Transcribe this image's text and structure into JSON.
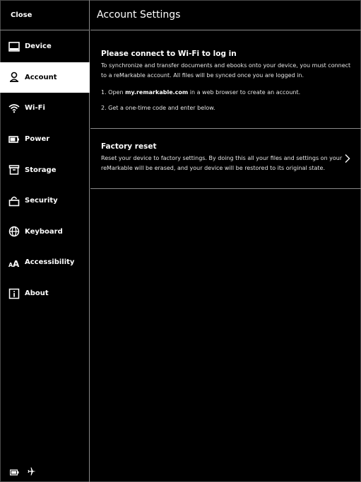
{
  "sidebar": {
    "close_label": "Close",
    "items": [
      {
        "label": "Device",
        "icon": "device-icon",
        "active": false
      },
      {
        "label": "Account",
        "icon": "account-icon",
        "active": true
      },
      {
        "label": "Wi-Fi",
        "icon": "wifi-icon",
        "active": false
      },
      {
        "label": "Power",
        "icon": "battery-icon",
        "active": false
      },
      {
        "label": "Storage",
        "icon": "storage-icon",
        "active": false
      },
      {
        "label": "Security",
        "icon": "lock-icon",
        "active": false
      },
      {
        "label": "Keyboard",
        "icon": "globe-icon",
        "active": false
      },
      {
        "label": "Accessibility",
        "icon": "text-size-icon",
        "active": false
      },
      {
        "label": "About",
        "icon": "info-icon",
        "active": false
      }
    ],
    "status_icons": [
      "battery-status-icon",
      "airplane-mode-icon"
    ]
  },
  "header": {
    "title": "Account Settings"
  },
  "login_section": {
    "title": "Please connect to Wi-Fi to log in",
    "body": "To synchronize and transfer documents and ebooks onto your device, you must connect to a reMarkable account. All files will be synced once you are logged in.",
    "step1_prefix": "1. Open ",
    "step1_link": "my.remarkable.com",
    "step1_suffix": " in a web browser to create an account.",
    "step2": "2. Get a one-time code and enter below."
  },
  "reset_section": {
    "title": "Factory reset",
    "body": "Reset your device to factory settings. By doing this all your files and settings on your reMarkable will be erased, and your device will be restored to its original state."
  },
  "colors": {
    "background": "#000000",
    "foreground": "#ffffff",
    "divider": "#8a8a8a"
  }
}
